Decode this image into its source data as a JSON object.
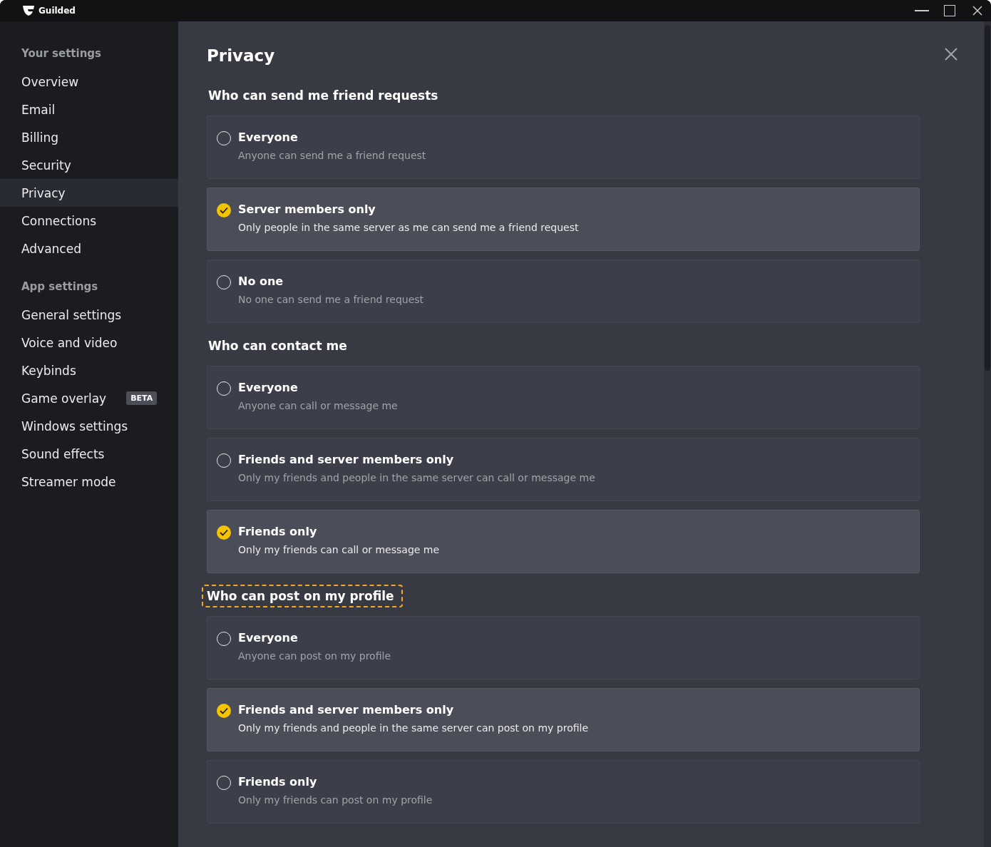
{
  "window": {
    "title": "Guilded"
  },
  "sidebar": {
    "groups": [
      {
        "heading": "Your settings",
        "items": [
          {
            "label": "Overview",
            "selected": false
          },
          {
            "label": "Email",
            "selected": false
          },
          {
            "label": "Billing",
            "selected": false
          },
          {
            "label": "Security",
            "selected": false
          },
          {
            "label": "Privacy",
            "selected": true
          },
          {
            "label": "Connections",
            "selected": false
          },
          {
            "label": "Advanced",
            "selected": false
          }
        ]
      },
      {
        "heading": "App settings",
        "items": [
          {
            "label": "General settings",
            "selected": false
          },
          {
            "label": "Voice and video",
            "selected": false
          },
          {
            "label": "Keybinds",
            "selected": false
          },
          {
            "label": "Game overlay",
            "selected": false,
            "badge": "BETA"
          },
          {
            "label": "Windows settings",
            "selected": false
          },
          {
            "label": "Sound effects",
            "selected": false
          },
          {
            "label": "Streamer mode",
            "selected": false
          }
        ]
      }
    ]
  },
  "page": {
    "title": "Privacy",
    "sections": [
      {
        "heading": "Who can send me friend requests",
        "focused": false,
        "options": [
          {
            "title": "Everyone",
            "description": "Anyone can send me a friend request",
            "selected": false
          },
          {
            "title": "Server members only",
            "description": "Only people in the same server as me can send me a friend request",
            "selected": true
          },
          {
            "title": "No one",
            "description": "No one can send me a friend request",
            "selected": false
          }
        ]
      },
      {
        "heading": "Who can contact me",
        "focused": false,
        "options": [
          {
            "title": "Everyone",
            "description": "Anyone can call or message me",
            "selected": false
          },
          {
            "title": "Friends and server members only",
            "description": "Only my friends and people in the same server can call or message me",
            "selected": false
          },
          {
            "title": "Friends only",
            "description": "Only my friends can call or message me",
            "selected": true
          }
        ]
      },
      {
        "heading": "Who can post on my profile",
        "focused": true,
        "options": [
          {
            "title": "Everyone",
            "description": "Anyone can post on my profile",
            "selected": false
          },
          {
            "title": "Friends and server members only",
            "description": "Only my friends and people in the same server can post on my profile",
            "selected": true
          },
          {
            "title": "Friends only",
            "description": "Only my friends can post on my profile",
            "selected": false
          }
        ]
      }
    ]
  }
}
